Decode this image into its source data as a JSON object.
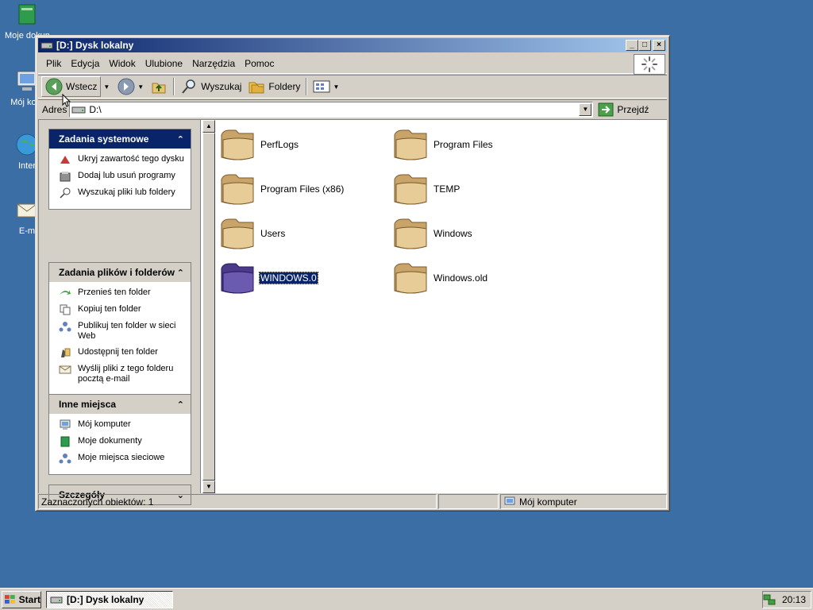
{
  "desktop": {
    "icons": [
      {
        "label": "Moje dokum",
        "icon": "my-documents-icon"
      },
      {
        "label": "Mój kom",
        "icon": "my-computer-icon"
      },
      {
        "label": "Inter",
        "icon": "internet-icon"
      },
      {
        "label": "E-m",
        "icon": "email-icon"
      }
    ]
  },
  "window": {
    "title": "[D:] Dysk lokalny",
    "menu": [
      "Plik",
      "Edycja",
      "Widok",
      "Ulubione",
      "Narzędzia",
      "Pomoc"
    ],
    "toolbar": {
      "back_label": "Wstecz",
      "search_label": "Wyszukaj",
      "folders_label": "Foldery"
    },
    "address": {
      "label": "Adres",
      "value": "D:\\",
      "go_label": "Przejdź"
    },
    "panels": {
      "system": {
        "title": "Zadania systemowe",
        "items": [
          {
            "label": "Ukryj zawartość tego dysku",
            "icon": "hide-icon"
          },
          {
            "label": "Dodaj lub usuń programy",
            "icon": "add-remove-programs-icon"
          },
          {
            "label": "Wyszukaj pliki lub foldery",
            "icon": "search-icon"
          }
        ]
      },
      "file_tasks": {
        "title": "Zadania plików i folderów",
        "items": [
          {
            "label": "Przenieś ten folder",
            "icon": "move-icon"
          },
          {
            "label": "Kopiuj ten folder",
            "icon": "copy-icon"
          },
          {
            "label": "Publikuj ten folder w sieci Web",
            "icon": "publish-web-icon"
          },
          {
            "label": "Udostępnij ten folder",
            "icon": "share-icon"
          },
          {
            "label": "Wyślij pliki z tego folderu pocztą e-mail",
            "icon": "email-icon"
          }
        ]
      },
      "other_places": {
        "title": "Inne miejsca",
        "items": [
          {
            "label": "Mój komputer",
            "icon": "my-computer-icon"
          },
          {
            "label": "Moje dokumenty",
            "icon": "my-documents-icon"
          },
          {
            "label": "Moje miejsca sieciowe",
            "icon": "network-places-icon"
          }
        ]
      },
      "details": {
        "title": "Szczegóły"
      }
    },
    "files": [
      {
        "name": "PerfLogs",
        "selected": false
      },
      {
        "name": "Program Files",
        "selected": false
      },
      {
        "name": "Program Files (x86)",
        "selected": false
      },
      {
        "name": "TEMP",
        "selected": false
      },
      {
        "name": "Users",
        "selected": false
      },
      {
        "name": "Windows",
        "selected": false
      },
      {
        "name": "WINDOWS.0",
        "selected": true
      },
      {
        "name": "Windows.old",
        "selected": false
      }
    ],
    "status": {
      "selection": "Zaznaczonych obiektów: 1",
      "location": "Mój komputer"
    }
  },
  "taskbar": {
    "start_label": "Start",
    "task_label": "[D:] Dysk lokalny",
    "clock": "20:13"
  },
  "colors": {
    "desktop": "#3a6ea5",
    "titlebar_start": "#0a246a",
    "titlebar_end": "#a6caf0",
    "selection": "#0a246a"
  }
}
